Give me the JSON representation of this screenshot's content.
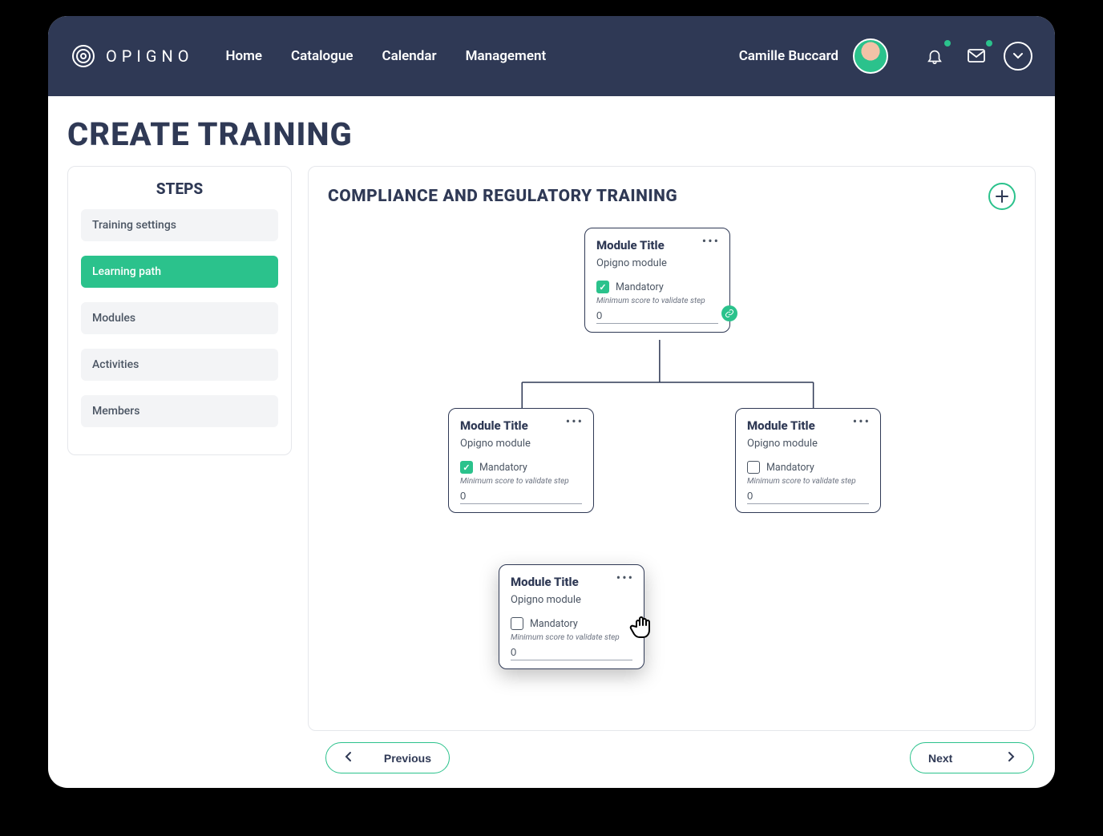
{
  "brand": "OPIGNO",
  "nav": {
    "home": "Home",
    "catalogue": "Catalogue",
    "calendar": "Calendar",
    "management": "Management"
  },
  "user": {
    "name": "Camille Buccard"
  },
  "page_title": "CREATE TRAINING",
  "steps": {
    "heading": "STEPS",
    "items": [
      {
        "label": "Training settings",
        "active": false
      },
      {
        "label": "Learning path",
        "active": true
      },
      {
        "label": "Modules",
        "active": false
      },
      {
        "label": "Activities",
        "active": false
      },
      {
        "label": "Members",
        "active": false
      }
    ]
  },
  "main_title": "COMPLIANCE AND REGULATORY TRAINING",
  "card": {
    "title": "Module Title",
    "subtitle": "Opigno module",
    "mandatory_label": "Mandatory",
    "min_score_label": "Minimum score to validate step"
  },
  "cards": [
    {
      "mandatory_checked": true,
      "score": "0",
      "has_link_badge": true
    },
    {
      "mandatory_checked": true,
      "score": "0",
      "has_link_badge": false
    },
    {
      "mandatory_checked": false,
      "score": "0",
      "has_link_badge": false
    },
    {
      "mandatory_checked": false,
      "score": "0",
      "has_link_badge": false
    }
  ],
  "buttons": {
    "previous": "Previous",
    "next": "Next"
  }
}
